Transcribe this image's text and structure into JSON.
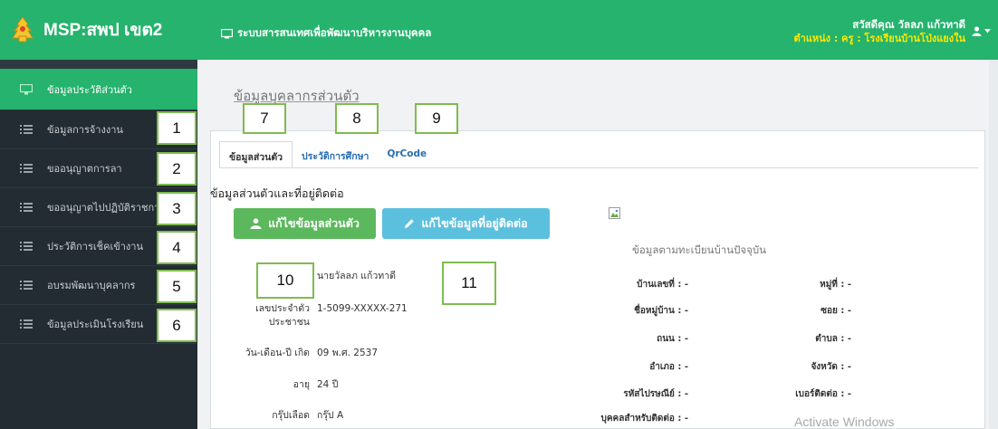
{
  "header": {
    "brand": "MSP:สพป เขต2",
    "system_title": "ระบบสารสนเทศเพื่อพัฒนาบริหารงานบุคคล",
    "greeting": "สวัสดีคุณ วัลลภ แก้วทาดี",
    "position": "ตำแหน่ง : ครู : โรงเรียนบ้านโป่งแยงใน",
    "user_icon": "user-icon",
    "caret_icon": "caret-down-icon"
  },
  "sidebar": {
    "items": [
      {
        "label": "ข้อมูลประวัติส่วนตัว",
        "icon": "desktop-icon"
      },
      {
        "label": "ข้อมูลการจ้างงาน",
        "icon": "list-icon"
      },
      {
        "label": "ขออนุญาตการลา",
        "icon": "list-icon"
      },
      {
        "label": "ขออนุญาตไปปฏิบัติราชการ",
        "icon": "list-icon"
      },
      {
        "label": "ประวัติการเช็คเข้างาน",
        "icon": "list-icon"
      },
      {
        "label": "อบรมพัฒนาบุคลากร",
        "icon": "list-icon"
      },
      {
        "label": "ข้อมูลประเมินโรงเรียน",
        "icon": "list-icon"
      }
    ]
  },
  "annotations": [
    "1",
    "2",
    "3",
    "4",
    "5",
    "6",
    "7",
    "8",
    "9",
    "10",
    "11"
  ],
  "main": {
    "page_title": "ข้อมูลบุคลากรส่วนตัว",
    "tabs": [
      "ข้อมูลส่วนตัว",
      "ประวัติการศึกษา",
      "QrCode"
    ],
    "section_title": "ข้อมูลส่วนตัวและที่อยู่ติดต่อ",
    "btn_edit_personal": "แก้ไขข้อมูลส่วนตัว",
    "btn_edit_address": "แก้ไขข้อมูลที่อยู่ติดต่อ",
    "personal": {
      "name": "นายวัลลภ แก้วทาดี",
      "id_label_1": "เลขประจำตัว",
      "id_label_2": "ประชาชน",
      "id_value": "1-5099-XXXXX-271",
      "dob_label": "วัน-เดือน-ปี เกิด",
      "dob_value": "09 พ.ศ. 2537",
      "age_label": "อายุ",
      "age_value": "24 ปี",
      "blood_label": "กรุ๊ปเลือด",
      "blood_value": "กรุ๊ป A"
    },
    "address": {
      "title": "ข้อมูลตามทะเบียนบ้านปัจจุบัน",
      "house_no": "บ้านเลขที่ : -",
      "moo": "หมู่ที่ : -",
      "village": "ชื่อหมู่บ้าน : -",
      "soi": "ซอย : -",
      "road": "ถนน : -",
      "tambon": "ตำบล : -",
      "amphoe": "อำเภอ : -",
      "province": "จังหวัด : -",
      "postcode": "รหัสไปรษณีย์ : -",
      "phone": "เบอร์ติดต่อ : -",
      "contact": "บุคคลสำหรับติดต่อ : -"
    }
  },
  "watermark": "Activate Windows",
  "colors": {
    "brand_green": "#25b36d",
    "sidebar_dark": "#232c33",
    "btn_green": "#5cb85c",
    "btn_blue": "#5bc0de",
    "position_yellow": "#ffe800"
  }
}
